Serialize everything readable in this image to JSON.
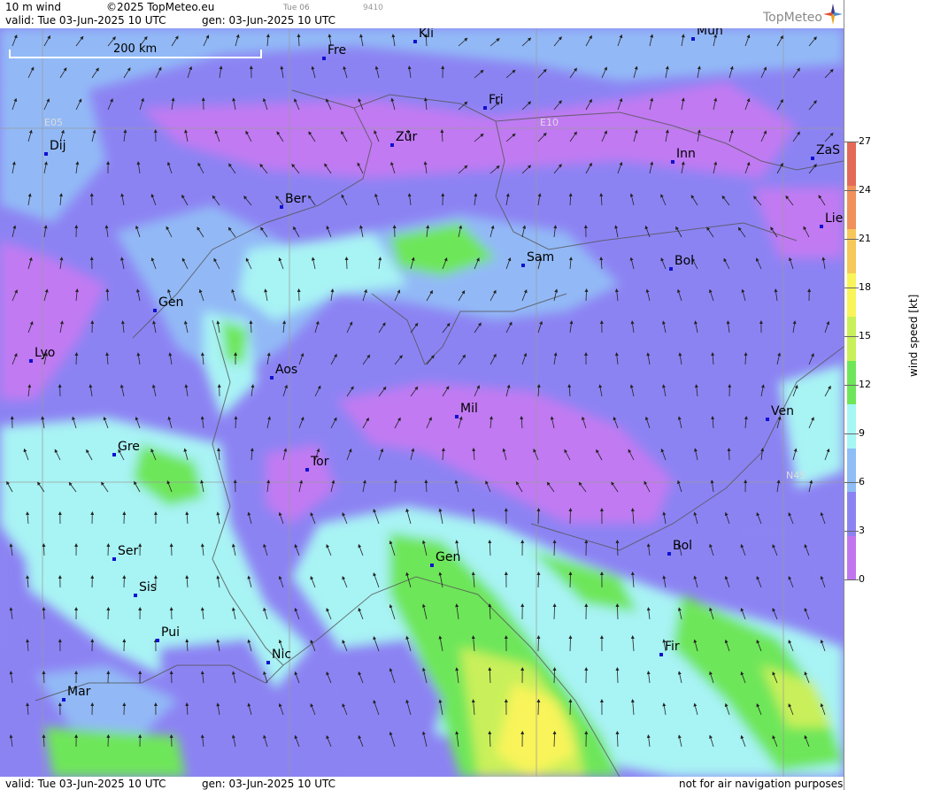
{
  "header": {
    "product": "10 m wind",
    "copyright": "©2025 TopMeteo.eu",
    "run_day": "Tue 06",
    "code": "9410",
    "valid": "valid:  Tue  03-Jun-2025  10 UTC",
    "gen": "gen: 03-Jun-2025 10 UTC",
    "brand": "TopMeteo"
  },
  "footer": {
    "valid": "valid:  Tue  03-Jun-2025  10 UTC",
    "gen": "gen: 03-Jun-2025 10 UTC",
    "disclaimer": "not for air navigation purposes"
  },
  "scale_bar": {
    "label": "200 km"
  },
  "grid_labels": {
    "e05": "E05",
    "e10": "E10",
    "n45": "N45"
  },
  "cities": [
    {
      "name": "Fre"
    },
    {
      "name": "Kli"
    },
    {
      "name": "Mün"
    },
    {
      "name": "Fri"
    },
    {
      "name": "Dij"
    },
    {
      "name": "Zür"
    },
    {
      "name": "Inn"
    },
    {
      "name": "ZaS"
    },
    {
      "name": "Ber"
    },
    {
      "name": "Lie"
    },
    {
      "name": "Sam"
    },
    {
      "name": "Bol"
    },
    {
      "name": "Gen"
    },
    {
      "name": "Lyo"
    },
    {
      "name": "Aos"
    },
    {
      "name": "Mil"
    },
    {
      "name": "Ven"
    },
    {
      "name": "Gre"
    },
    {
      "name": "Tor"
    },
    {
      "name": "Gen"
    },
    {
      "name": "Bol"
    },
    {
      "name": "Ser"
    },
    {
      "name": "Sis"
    },
    {
      "name": "Pui"
    },
    {
      "name": "Nic"
    },
    {
      "name": "Fir"
    },
    {
      "name": "Mar"
    }
  ],
  "legend": {
    "title": "wind speed [kt]",
    "ticks": [
      "27",
      "24",
      "21",
      "18",
      "15",
      "12",
      "9",
      "6",
      "3",
      "0"
    ],
    "colors": [
      "#e36a59",
      "#f0905b",
      "#f6c85a",
      "#f8f45a",
      "#c9f05a",
      "#6ee65a",
      "#a6f6f6",
      "#8fbdf5",
      "#8c83f3",
      "#c176f0"
    ]
  },
  "palette": {
    "calm": "#c17af2",
    "light": "#8c83f3",
    "moderate": "#92b9f6",
    "fresh": "#a8f3f4",
    "strong": "#6ee65a",
    "very_strong": "#c9f05a",
    "gale": "#f8f45a"
  }
}
